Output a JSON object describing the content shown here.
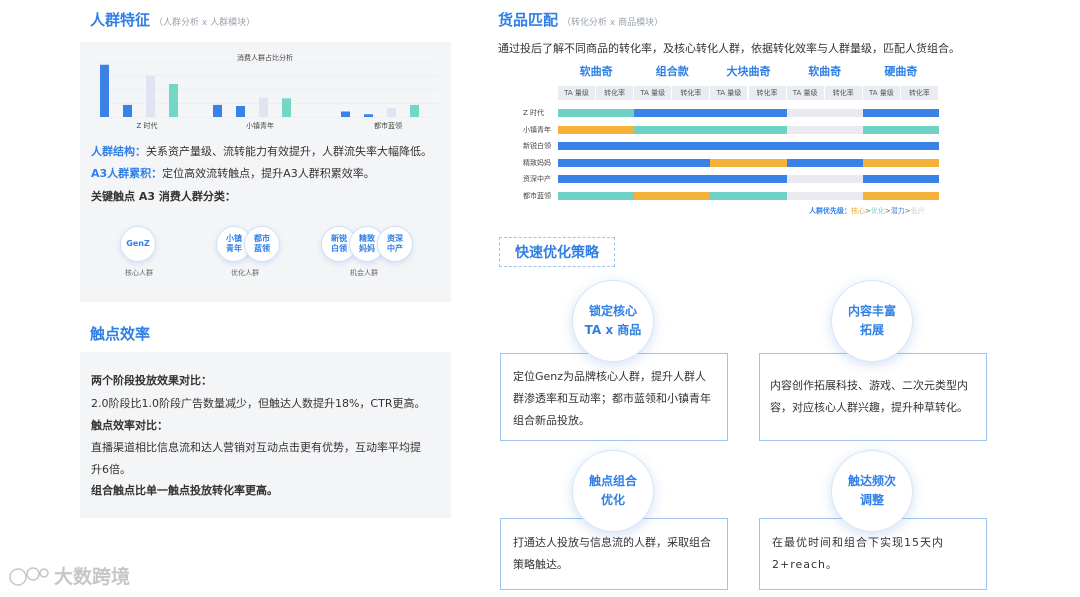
{
  "left": {
    "section1": {
      "title": "人群特征",
      "subtitle": "（人群分析 x 人群模块）",
      "chart_title": "消费人群占比分析",
      "chart_data": {
        "type": "bar",
        "categories": [
          "Z 时代",
          "小镇青年",
          "都市蓝领"
        ],
        "series": [
          {
            "values": [
              95,
              22,
              10
            ],
            "color": "#3b82e8"
          },
          {
            "values": [
              22,
              20,
              5
            ],
            "color": "#3b82e8"
          },
          {
            "values": [
              75,
              35,
              16
            ],
            "color": "#dfe3f2"
          },
          {
            "values": [
              60,
              34,
              22
            ],
            "color": "#74d6c4"
          }
        ],
        "ylim": [
          0,
          100
        ]
      },
      "para1_label": "人群结构：",
      "para1_text": "关系资产量级、流转能力有效提升，人群流失率大幅降低。",
      "para2_label": "A3人群累积：",
      "para2_text": "定位高效流转触点，提升A3人群积累效率。",
      "para3": "关键触点 A3 消费人群分类：",
      "groups": [
        {
          "bubbles": [
            "GenZ"
          ],
          "caption": "核心人群"
        },
        {
          "bubbles": [
            "小镇\n青年",
            "都市\n蓝领"
          ],
          "caption": "优化人群"
        },
        {
          "bubbles": [
            "新锐\n白领",
            "精致\n妈妈",
            "资深\n中产"
          ],
          "caption": "机会人群"
        }
      ]
    },
    "section2": {
      "title": "触点效率",
      "line1": "两个阶段投放效果对比：",
      "line2": "2.0阶段比1.0阶段广告数量减少，但触达人数提升18%，CTR更高。",
      "line3": "触点效率对比：",
      "line4a": "直播渠道相比信息流和达人营销对互动点击更有优势，互动率平均提",
      "line4b": "升6倍。",
      "line5": "组合触点比单一触点投放转化率更高。"
    }
  },
  "right": {
    "section1": {
      "title": "货品匹配",
      "subtitle": "（转化分析 x 商品模块）",
      "intro": "通过投后了解不同商品的转化率，及核心转化人群，依据转化效率与人群量级，匹配人货组合。",
      "products": [
        "软曲奇",
        "组合款",
        "大块曲奇",
        "软曲奇",
        "硬曲奇"
      ],
      "col_headers": [
        "TA 量级",
        "转化率"
      ],
      "rows": [
        {
          "label": "Z 时代",
          "cells": [
            "t",
            "t",
            "b",
            "b",
            "b",
            "b",
            "g",
            "g",
            "b",
            "b"
          ]
        },
        {
          "label": "小镇青年",
          "cells": [
            "y",
            "y",
            "t",
            "t",
            "t",
            "t",
            "g",
            "g",
            "t",
            "t"
          ]
        },
        {
          "label": "新锐白领",
          "cells": [
            "b",
            "b",
            "b",
            "b",
            "b",
            "b",
            "b",
            "b",
            "b",
            "b"
          ]
        },
        {
          "label": "精致妈妈",
          "cells": [
            "b",
            "b",
            "b",
            "b",
            "y",
            "y",
            "b",
            "b",
            "y",
            "y"
          ]
        },
        {
          "label": "资深中产",
          "cells": [
            "b",
            "b",
            "b",
            "b",
            "b",
            "b",
            "g",
            "g",
            "b",
            "b"
          ]
        },
        {
          "label": "都市蓝领",
          "cells": [
            "t",
            "t",
            "y",
            "y",
            "t",
            "t",
            "g",
            "g",
            "y",
            "y"
          ]
        }
      ],
      "legend_label": "人群优先级：",
      "legend_items": [
        {
          "text": "核心",
          "color": "#f5a623"
        },
        {
          "text": ">",
          "color": "#666"
        },
        {
          "text": "优化",
          "color": "#74d6c4"
        },
        {
          "text": ">",
          "color": "#666"
        },
        {
          "text": "潜力",
          "color": "#3b82e8"
        },
        {
          "text": ">",
          "color": "#666"
        },
        {
          "text": "低兴",
          "color": "#c9cdd6"
        }
      ],
      "colors": {
        "b": "#3b82e8",
        "t": "#6fd0c6",
        "y": "#f5b23a",
        "g": "#e8eaf0"
      }
    },
    "section2": {
      "title": "快速优化策略",
      "cards": [
        {
          "circle": "锁定核心\nTA x 商品",
          "text": "定位Genz为品牌核心人群，提升人群人群渗透率和互动率；都市蓝领和小镇青年组合新品投放。"
        },
        {
          "circle": "内容丰富\n拓展",
          "text": "内容创作拓展科技、游戏、二次元类型内容，对应核心人群兴趣，提升种草转化。"
        },
        {
          "circle": "触点组合\n优化",
          "text": "打通达人投放与信息流的人群，采取组合策略触达。"
        },
        {
          "circle": "触达频次\n调整",
          "text": "在最优时间和组合下实现15天内2+reach。"
        }
      ]
    }
  },
  "watermark": "大数跨境"
}
